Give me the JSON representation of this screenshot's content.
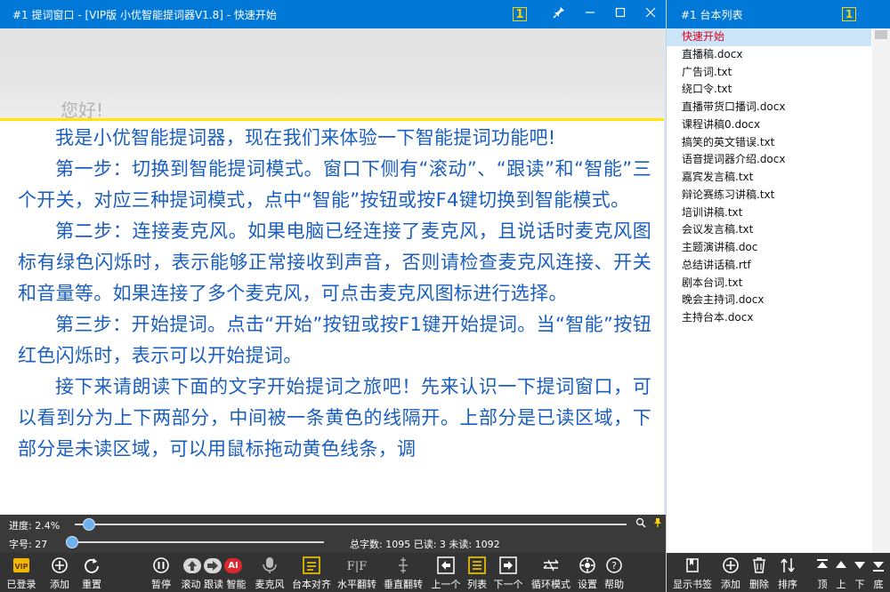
{
  "window": {
    "title": "#1 提词窗口 - [VIP版 小优智能提词器V1.8] - 快速开始",
    "badge": "1",
    "pin_icon": "pin-icon",
    "min_icon": "minimize-icon",
    "max_icon": "maximize-icon",
    "close_icon": "close-icon"
  },
  "prompter": {
    "read_line": "您好!",
    "paragraphs": [
      "我是小优智能提词器，现在我们来体验一下智能提词功能吧!",
      "第一步：切换到智能提词模式。窗口下侧有“滚动”、“跟读”和“智能”三个开关，对应三种提词模式，点中“智能”按钮或按F4键切换到智能模式。",
      "第二步：连接麦克风。如果电脑已经连接了麦克风，且说话时麦克风图标有绿色闪烁时，表示能够正常接收到声音，否则请检查麦克风连接、开关和音量等。如果连接了多个麦克风，可点击麦克风图标进行选择。",
      "第三步：开始提词。点击“开始”按钮或按F1键开始提词。当“智能”按钮红色闪烁时，表示可以开始提词。",
      "接下来请朗读下面的文字开始提词之旅吧！先来认识一下提词窗口，可以看到分为上下两部分，中间被一条黄色的线隔开。上部分是已读区域，下部分是未读区域，可以用鼠标拖动黄色线条，调"
    ],
    "text_color": "#1a5fc0",
    "divider_color": "#ffe600"
  },
  "status": {
    "progress_label": "进度: 2.4%",
    "progress_value": 0.024,
    "font_label": "字号: 27",
    "font_value": 27,
    "stats": "总字数: 1095 已读: 3 未读: 1092"
  },
  "toolbar": [
    {
      "name": "vip-login",
      "label": "已登录",
      "icon": "vip-icon"
    },
    {
      "name": "add",
      "label": "添加",
      "icon": "plus-circle-icon"
    },
    {
      "name": "reset",
      "label": "重置",
      "icon": "refresh-icon"
    },
    {
      "name": "pause",
      "label": "暂停",
      "icon": "pause-icon"
    },
    {
      "name": "mode-switch",
      "label": "滚动 跟读 智能",
      "icon": "mode-toggle-icon"
    },
    {
      "name": "mic",
      "label": "麦克风",
      "icon": "microphone-icon"
    },
    {
      "name": "align",
      "label": "台本对齐",
      "icon": "align-icon"
    },
    {
      "name": "hflip",
      "label": "水平翻转",
      "icon": "flip-horizontal-icon"
    },
    {
      "name": "vflip",
      "label": "垂直翻转",
      "icon": "flip-vertical-icon"
    },
    {
      "name": "prev",
      "label": "上一个",
      "icon": "prev-icon"
    },
    {
      "name": "list",
      "label": "列表",
      "icon": "list-icon"
    },
    {
      "name": "next",
      "label": "下一个",
      "icon": "next-icon"
    },
    {
      "name": "loop",
      "label": "循环模式",
      "icon": "loop-icon"
    },
    {
      "name": "settings",
      "label": "设置",
      "icon": "gear-icon"
    },
    {
      "name": "help",
      "label": "帮助",
      "icon": "help-icon"
    }
  ],
  "script_list": {
    "title": "#1 台本列表",
    "badge": "1",
    "items": [
      "快速开始",
      "直播稿.docx",
      "广告词.txt",
      "绕口令.txt",
      "直播带货口播词.docx",
      "课程讲稿0.docx",
      "搞笑的英文错误.txt",
      "语音提词器介绍.docx",
      "嘉宾发言稿.txt",
      "辩论赛练习讲稿.txt",
      "培训讲稿.txt",
      "会议发言稿.txt",
      "主题演讲稿.doc",
      "总结讲话稿.rtf",
      "剧本台词.txt",
      "晚会主持词.docx",
      "主持台本.docx"
    ],
    "selected_index": 0,
    "toolbar": [
      {
        "name": "bookmark",
        "label": "显示书签",
        "icon": "bookmark-icon"
      },
      {
        "name": "add",
        "label": "添加",
        "icon": "plus-circle-icon"
      },
      {
        "name": "delete",
        "label": "删除",
        "icon": "trash-icon"
      },
      {
        "name": "sort",
        "label": "排序",
        "icon": "sort-icon"
      },
      {
        "name": "top",
        "label": "顶",
        "icon": "move-top-icon"
      },
      {
        "name": "up",
        "label": "上",
        "icon": "move-up-icon"
      },
      {
        "name": "down",
        "label": "下",
        "icon": "move-down-icon"
      },
      {
        "name": "bottom",
        "label": "底",
        "icon": "move-bottom-icon"
      }
    ]
  }
}
